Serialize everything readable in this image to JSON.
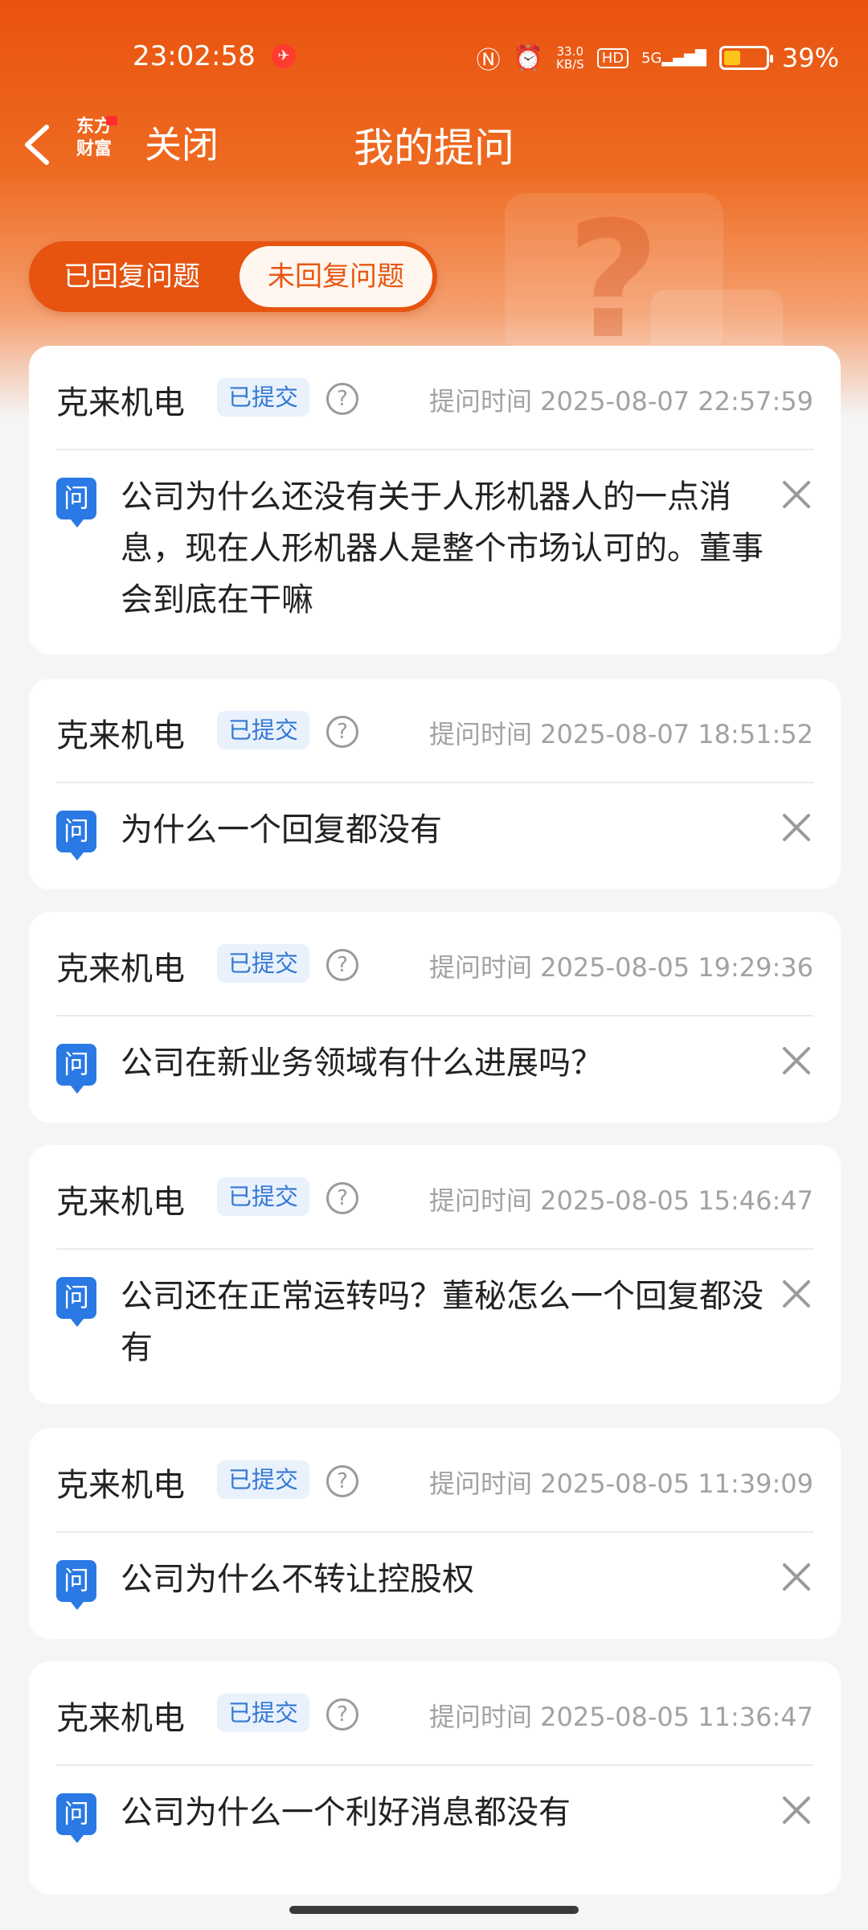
{
  "status_bar": {
    "time": "23:02:58",
    "net_speed_value": "33.0",
    "net_speed_unit": "KB/S",
    "hd": "HD",
    "signal": "5G",
    "battery_percent": "39%",
    "battery_level": 0.39
  },
  "nav": {
    "brand_line1": "东方",
    "brand_line2": "财富",
    "close_label": "关闭",
    "title": "我的提问"
  },
  "tabs": {
    "answered": "已回复问题",
    "unanswered": "未回复问题",
    "active": "unanswered"
  },
  "colors": {
    "brand_orange": "#e9530f",
    "badge_blue": "#3478d4",
    "question_icon_blue": "#2a79e4"
  },
  "question_icon_label": "问",
  "questions": [
    {
      "company": "克来机电",
      "status": "已提交",
      "time": "提问时间 2025-08-07 22:57:59",
      "text": "公司为什么还没有关于人形机器人的一点消息，现在人形机器人是整个市场认可的。董事会到底在干嘛"
    },
    {
      "company": "克来机电",
      "status": "已提交",
      "time": "提问时间 2025-08-07 18:51:52",
      "text": "为什么一个回复都没有"
    },
    {
      "company": "克来机电",
      "status": "已提交",
      "time": "提问时间 2025-08-05 19:29:36",
      "text": "公司在新业务领域有什么进展吗？"
    },
    {
      "company": "克来机电",
      "status": "已提交",
      "time": "提问时间 2025-08-05 15:46:47",
      "text": "公司还在正常运转吗？董秘怎么一个回复都没有"
    },
    {
      "company": "克来机电",
      "status": "已提交",
      "time": "提问时间 2025-08-05 11:39:09",
      "text": "公司为什么不转让控股权"
    },
    {
      "company": "克来机电",
      "status": "已提交",
      "time": "提问时间 2025-08-05 11:36:47",
      "text": "公司为什么一个利好消息都没有"
    }
  ]
}
